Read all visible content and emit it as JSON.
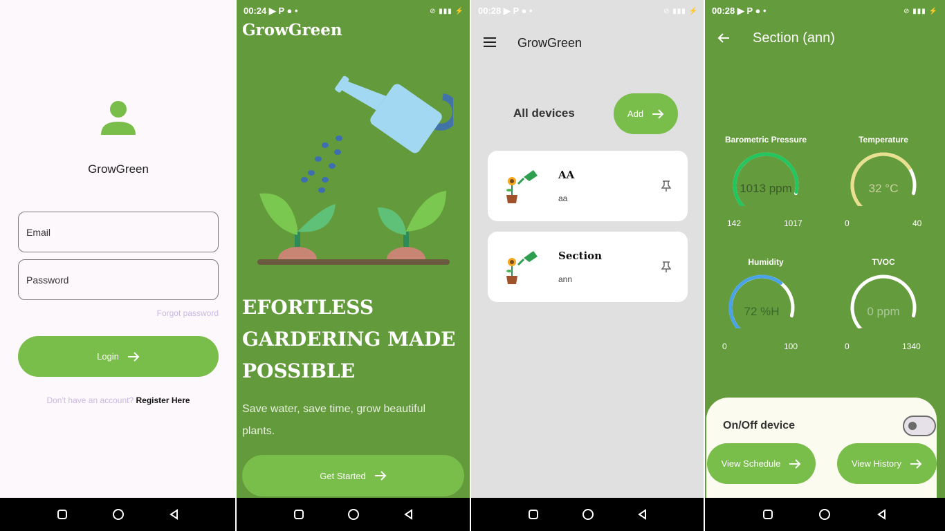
{
  "status": {
    "time_s2": "00:24",
    "time_s3": "00:28",
    "time_s4": "00:28",
    "icons_text": "⊘ ▮▮▮ ⚡"
  },
  "login": {
    "app_name": "GrowGreen",
    "email_placeholder": "Email",
    "password_placeholder": "Password",
    "forgot": "Forgot password",
    "login_btn": "Login",
    "no_account": "Don't have an account?",
    "register": "Register Here"
  },
  "welcome": {
    "brand": "GrowGreen",
    "headline": "EFORTLESS GARDERING MADE POSSIBLE",
    "subline": "Save water, save time, grow beautiful plants.",
    "cta": "Get Started"
  },
  "devices": {
    "title": "GrowGreen",
    "heading": "All devices",
    "add_btn": "Add",
    "items": [
      {
        "name": "AA",
        "sub": "aa"
      },
      {
        "name": "Section",
        "sub": "ann"
      }
    ]
  },
  "section": {
    "title": "Section (ann)",
    "gauges": [
      {
        "label": "Barometric Pressure",
        "value": "1013 ppm",
        "min": "142",
        "max": "1017",
        "fraction": 0.99,
        "color": "#22c55e",
        "val_color": "#3a5a2a"
      },
      {
        "label": "Temperature",
        "value": "32 °C",
        "min": "0",
        "max": "40",
        "fraction": 0.8,
        "color": "#e8e08e",
        "val_color": "#c8d3a0"
      },
      {
        "label": "Humidity",
        "value": "72 %H",
        "min": "0",
        "max": "100",
        "fraction": 0.72,
        "color": "#4aa3e8",
        "val_color": "#3a6a2a"
      },
      {
        "label": "TVOC",
        "value": "0 ppm",
        "min": "0",
        "max": "1340",
        "fraction": 0.0,
        "color": "#e74c3c",
        "val_color": "#aac89a"
      }
    ],
    "onoff_label": "On/Off device",
    "schedule_btn": "View Schedule",
    "history_btn": "View History"
  }
}
